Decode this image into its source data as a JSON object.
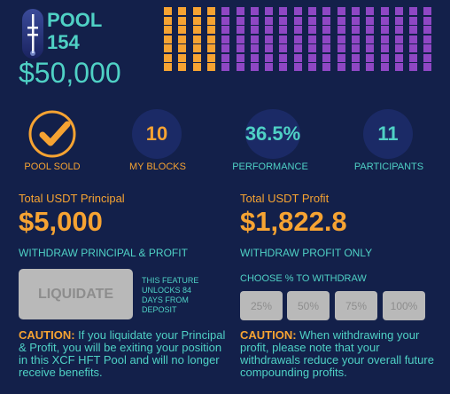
{
  "pool": {
    "name": "POOL",
    "number": "154",
    "amount": "$50,000",
    "grid": {
      "orange_columns": 4,
      "purple_columns": 15,
      "rows": 7,
      "orange_color": "#f6a332",
      "purple_color": "#8f47c4"
    }
  },
  "stats": [
    {
      "value": "",
      "label": "POOL SOLD",
      "icon": "checkmark-icon"
    },
    {
      "value": "10",
      "label": "MY BLOCKS"
    },
    {
      "value": "36.5%",
      "label": "PERFORMANCE"
    },
    {
      "value": "11",
      "label": "PARTICIPANTS"
    }
  ],
  "principal": {
    "label": "Total USDT Principal",
    "amount": "$5,000",
    "withdraw_label": "WITHDRAW PRINCIPAL & PROFIT",
    "button": "LIQUIDATE",
    "note": "THIS FEATURE UNLOCKS 84 DAYS FROM DEPOSIT",
    "caution_title": "CAUTION:",
    "caution_text": " If you liquidate your Principal & Profit, you will be exiting your position in this XCF HFT Pool and will no longer receive benefits."
  },
  "profit": {
    "label": "Total USDT Profit",
    "amount": "$1,822.8",
    "withdraw_label": "WITHDRAW PROFIT ONLY",
    "choose_label": "CHOOSE % TO WITHDRAW",
    "options": [
      "25%",
      "50%",
      "75%",
      "100%"
    ],
    "caution_title": "CAUTION:",
    "caution_text": " When withdrawing your profit, please note that your withdrawals reduce your overall future compounding profits."
  },
  "colors": {
    "background": "#13204a",
    "orange": "#f6a332",
    "teal": "#4fd1c5",
    "disabled": "#b9b9b9"
  }
}
